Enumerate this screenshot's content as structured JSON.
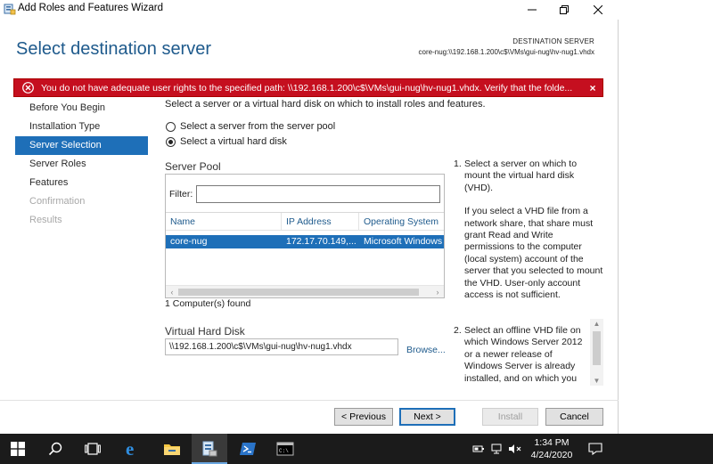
{
  "window": {
    "title": "Add Roles and Features Wizard"
  },
  "header": {
    "page_title": "Select destination server",
    "dest_label": "DESTINATION SERVER",
    "dest_value": "core-nug:\\\\192.168.1.200\\c$\\VMs\\gui-nug\\hv-nug1.vhdx"
  },
  "error": {
    "message": "You do not have adequate user rights to the specified path: \\\\192.168.1.200\\c$\\VMs\\gui-nug\\hv-nug1.vhdx. Verify that the folde...",
    "close": "×"
  },
  "nav": {
    "items": [
      {
        "label": "Before You Begin"
      },
      {
        "label": "Installation Type"
      },
      {
        "label": "Server Selection"
      },
      {
        "label": "Server Roles"
      },
      {
        "label": "Features"
      },
      {
        "label": "Confirmation"
      },
      {
        "label": "Results"
      }
    ]
  },
  "main": {
    "intro": "Select a server or a virtual hard disk on which to install roles and features.",
    "radio_pool": "Select a server from the server pool",
    "radio_vhd": "Select a virtual hard disk",
    "selected_option": "Select a virtual hard disk",
    "pool_heading": "Server Pool",
    "filter_label": "Filter:",
    "filter_value": "",
    "columns": [
      "Name",
      "IP Address",
      "Operating System"
    ],
    "rows": [
      {
        "name": "core-nug",
        "ip": "172.17.70.149,...",
        "os": "Microsoft Windows"
      }
    ],
    "count": "1 Computer(s) found",
    "vhd_heading": "Virtual Hard Disk",
    "vhd_path": "\\\\192.168.1.200\\c$\\VMs\\gui-nug\\hv-nug1.vhdx",
    "browse": "Browse..."
  },
  "help": {
    "num1": "1.",
    "step1": "Select a server on which to mount the virtual hard disk (VHD).",
    "step1_note": "If you select a VHD file from a network share, that share must grant Read and Write permissions to the computer (local system) account of the server that you selected to mount the VHD. User-only account access is not sufficient.",
    "num2": "2.",
    "step2": "Select an offline VHD file on which Windows Server 2012 or a newer release of Windows Server is already installed, and on which you want to install"
  },
  "buttons": {
    "previous": "< Previous",
    "next": "Next >",
    "install": "Install",
    "cancel": "Cancel"
  },
  "taskbar": {
    "time": "1:34 PM",
    "date": "4/24/2020"
  },
  "colors": {
    "accent": "#1e6fb8",
    "error": "#c50f1f",
    "title_blue": "#1e5a8c",
    "taskbar": "#1b1b1b"
  }
}
